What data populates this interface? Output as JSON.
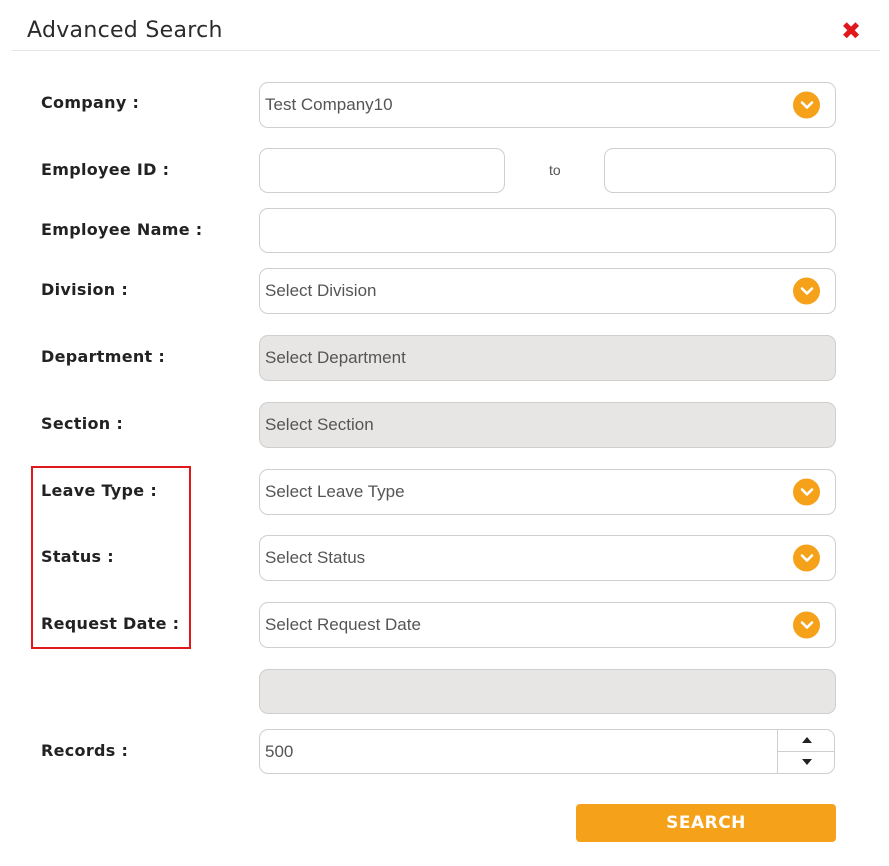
{
  "dialog": {
    "title": "Advanced Search",
    "close_icon": "close-x-icon",
    "accent_color": "#f5a21a",
    "highlight_color": "#e0181b"
  },
  "form": {
    "company": {
      "label": "Company :",
      "value": "Test Company10"
    },
    "employee_id": {
      "label": "Employee ID :",
      "from_value": "",
      "to_label": "to",
      "to_value": ""
    },
    "employee_name": {
      "label": "Employee Name :",
      "value": ""
    },
    "division": {
      "label": "Division :",
      "value": "Select Division"
    },
    "department": {
      "label": "Department :",
      "value": "Select Department"
    },
    "section": {
      "label": "Section :",
      "value": "Select Section"
    },
    "leave_type": {
      "label": "Leave Type :",
      "value": "Select Leave Type"
    },
    "status": {
      "label": "Status :",
      "value": "Select Status"
    },
    "request_date": {
      "label": "Request Date :",
      "value": "Select Request Date"
    },
    "extra_field": {
      "value": ""
    },
    "records": {
      "label": "Records :",
      "value": "500"
    }
  },
  "actions": {
    "search_label": "SEARCH"
  }
}
